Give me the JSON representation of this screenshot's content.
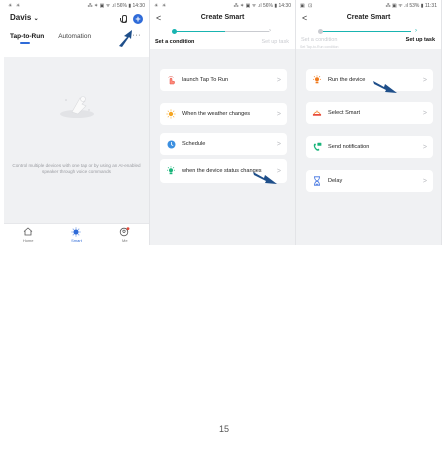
{
  "screen1": {
    "status_left": "☀ ☀",
    "status_right": "⁂ ✶ ▣ ᯤ .ıl 56% ▮ 14:30",
    "home_name": "Davis",
    "tabs": [
      "Tap-to-Run",
      "Automation"
    ],
    "more": "···",
    "empty_text": "Control multiple devices with one tap or by using an AI-enabled speaker through voice commands",
    "nav": [
      "Home",
      "Smart",
      "Me"
    ]
  },
  "screen2": {
    "status_left": "☀ ☀",
    "status_right": "⁂ ✶ ▣ ᯤ .ıl 56% ▮ 14:30",
    "title": "Create Smart",
    "step1": "Set a condition",
    "step2": "Set up task",
    "options": [
      "launch Tap To Run",
      "When the weather changes",
      "Schedule",
      "when the device status changes"
    ]
  },
  "screen3": {
    "status_left": "▣ ⊡",
    "status_right": "⁂ ▣ ᯤ .ıl 53% ▮ 11:31",
    "title": "Create Smart",
    "step1": "Set a condition",
    "step1_sub": "Set Tap-to-Run condition",
    "step2": "Set up task",
    "options": [
      "Run the device",
      "Select Smart",
      "Send notification",
      "Delay"
    ]
  },
  "page_number": "15",
  "colors": {
    "accent_blue": "#2f6bd8",
    "teal": "#19b4b1",
    "background": "#f0f1f3"
  },
  "arrow_chevron": ">"
}
